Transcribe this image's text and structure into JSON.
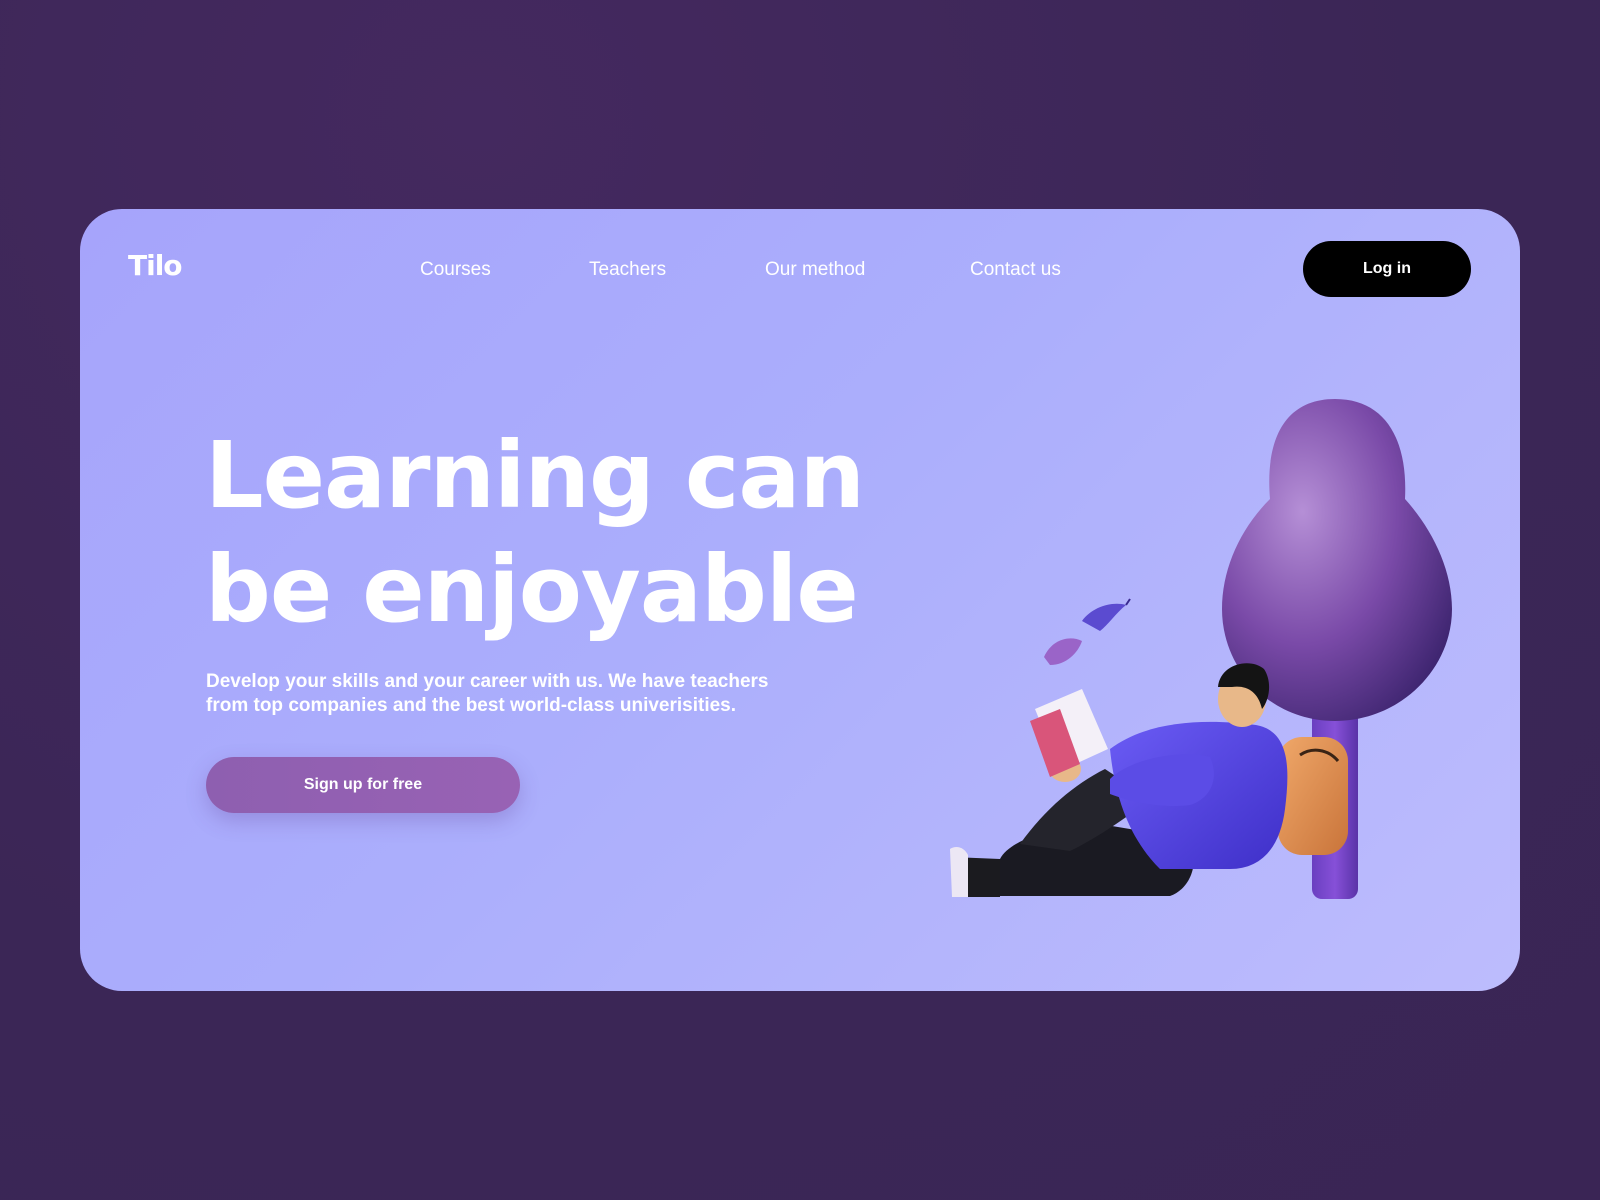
{
  "brand": {
    "logo_text": "Tilo"
  },
  "nav": {
    "items": [
      {
        "label": "Courses"
      },
      {
        "label": "Teachers"
      },
      {
        "label": "Our method"
      },
      {
        "label": "Contact us"
      }
    ],
    "login_label": "Log in"
  },
  "hero": {
    "headline_line1": "Learning can",
    "headline_line2": "be enjoyable",
    "subtext_line1": "Develop your skills and your career with us. We have teachers",
    "subtext_line2": "from top companies and the best world-class univerisities.",
    "cta_label": "Sign up for free"
  },
  "colors": {
    "page_background": "#3b2656",
    "card_background": "#abaefc",
    "login_button": "#000000",
    "cta_button": "#9262b2",
    "text": "#ffffff"
  },
  "illustration": {
    "icons": [
      "tree-icon",
      "student-reading-icon",
      "book-icon",
      "backpack-icon",
      "leaf-icon"
    ]
  }
}
